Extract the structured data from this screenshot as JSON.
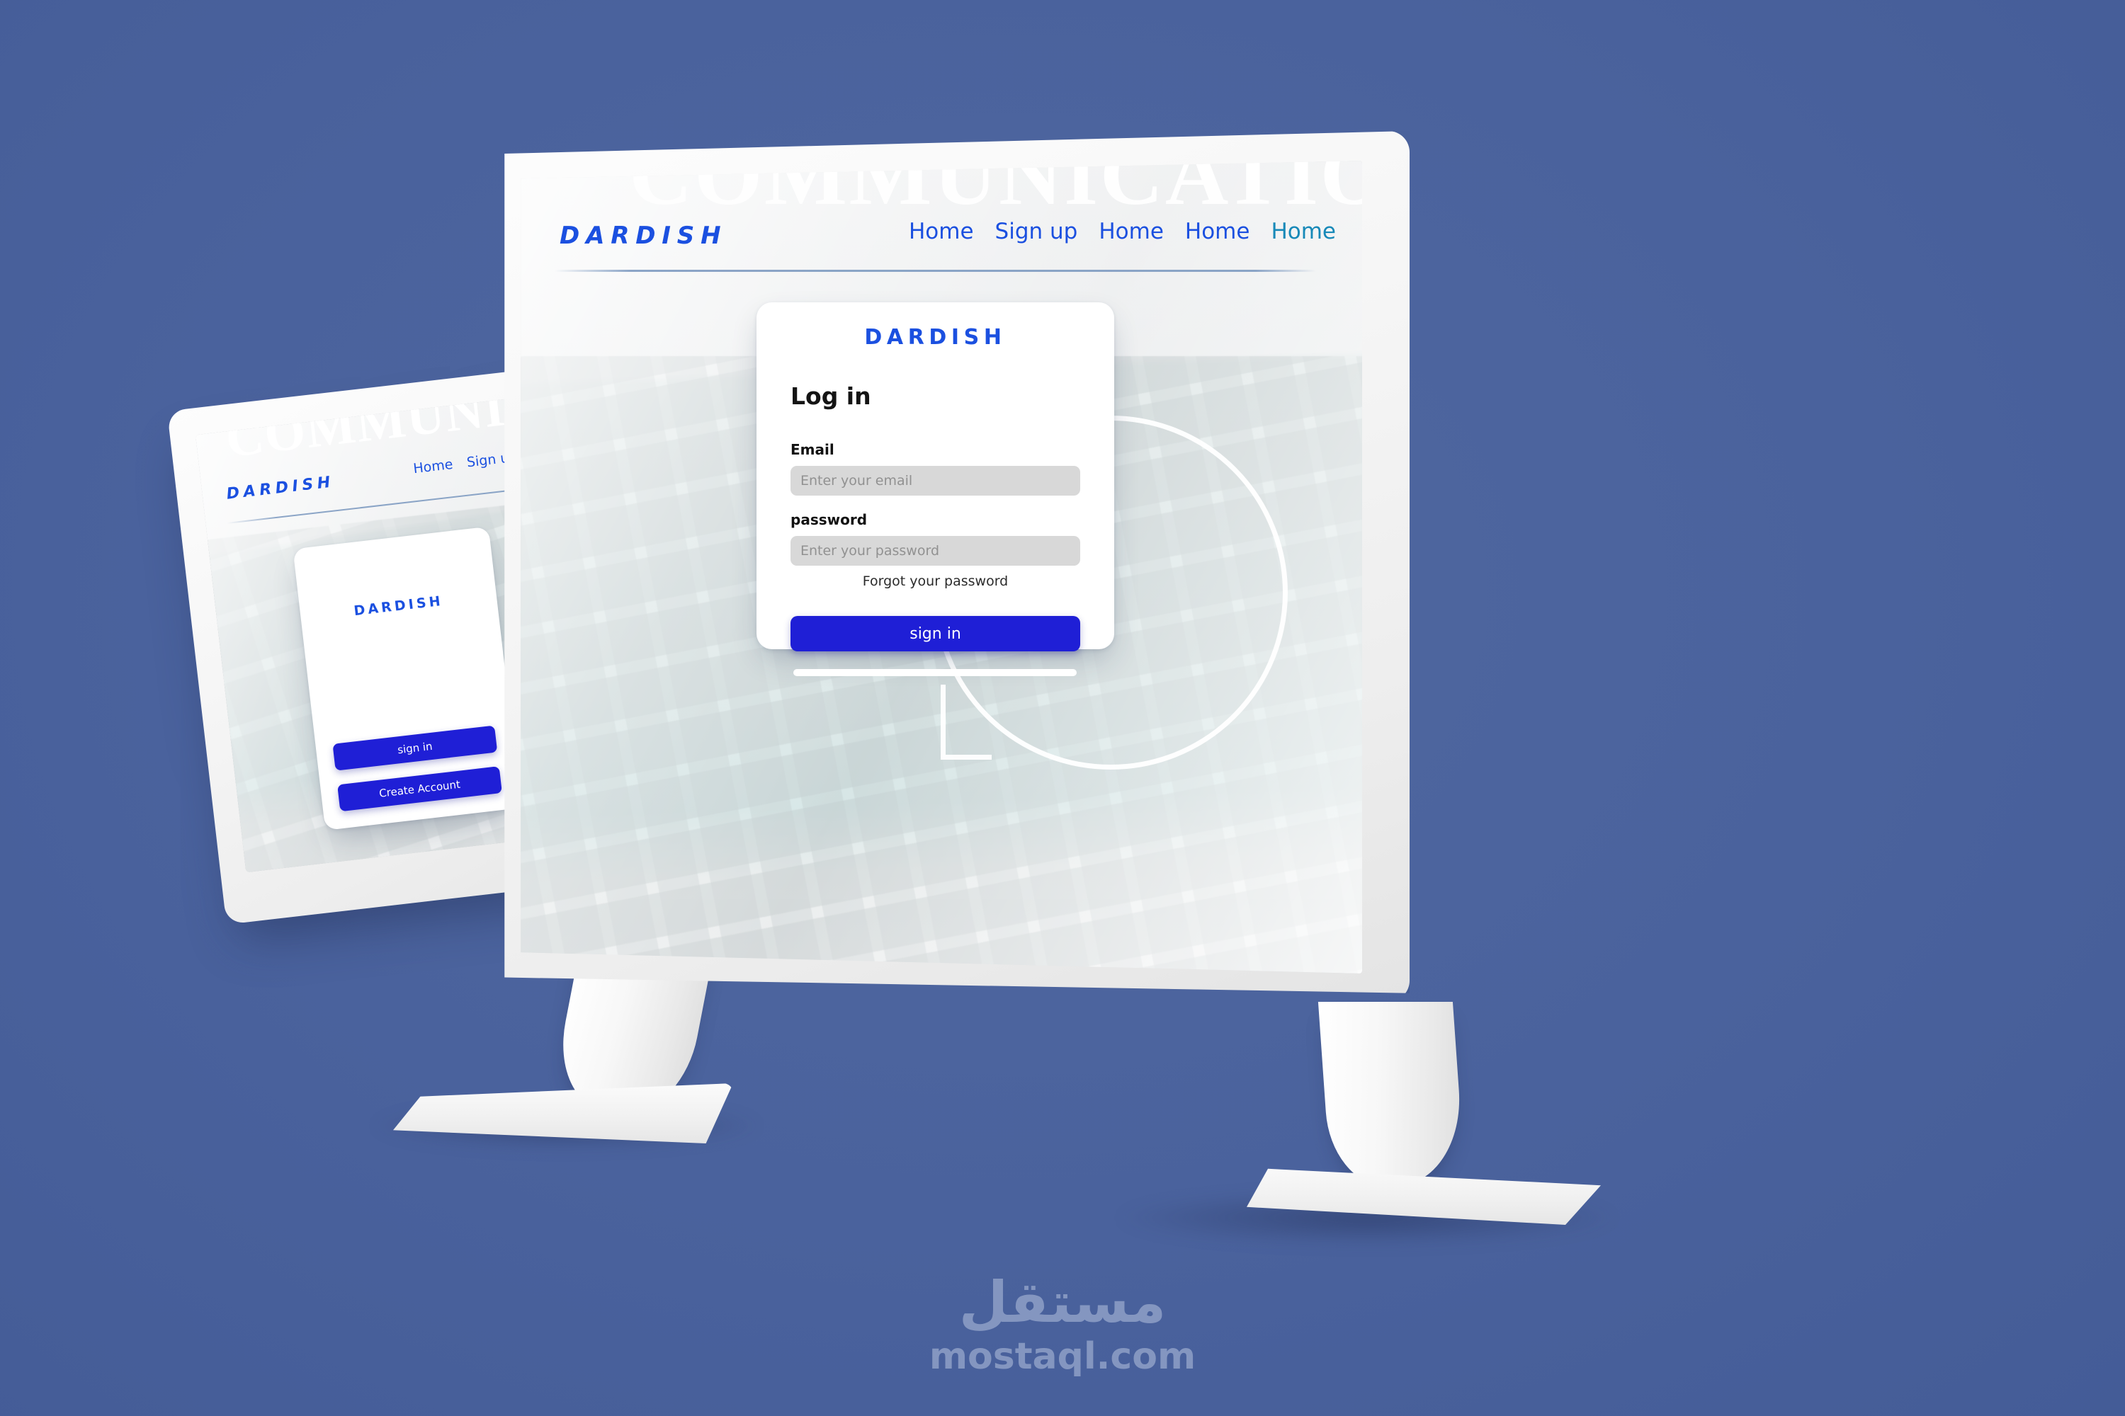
{
  "colors": {
    "page_background": "#4b649f",
    "brand_blue": "#1b50e0",
    "button_blue": "#1f1fd6",
    "accent_teal": "#1789b8",
    "input_grey": "#d8d8d8",
    "watermark_blue": "#8496c0",
    "bezel_white": "#f6f6f6"
  },
  "site": {
    "logo": "DARDISH",
    "hero_watermark": "COMMUNICATION",
    "nav": [
      {
        "label": "Home",
        "accent": false
      },
      {
        "label": "Sign up",
        "accent": false
      },
      {
        "label": "Home",
        "accent": false
      },
      {
        "label": "Home",
        "accent": false
      },
      {
        "label": "Home",
        "accent": true
      }
    ]
  },
  "login_card": {
    "logo": "DARDISH",
    "title": "Log in",
    "email": {
      "label": "Email",
      "placeholder": "Enter your email",
      "value": ""
    },
    "password": {
      "label": "password",
      "placeholder": "Enter your password",
      "value": ""
    },
    "forgot_label": "Forgot your password",
    "submit_label": "sign in"
  },
  "welcome_card": {
    "logo": "DARDISH",
    "sign_in_label": "sign in",
    "create_account_label": "Create Account"
  },
  "watermark": {
    "arabic": "مستقل",
    "latin": "mostaql.com"
  }
}
